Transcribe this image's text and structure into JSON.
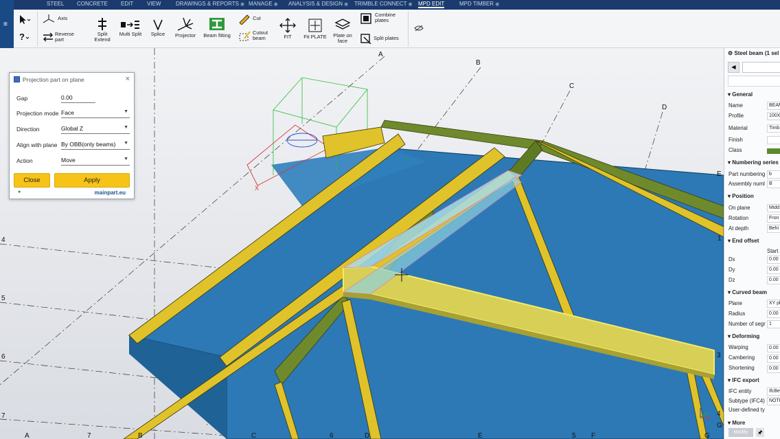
{
  "tabs": [
    "STEEL",
    "CONCRETE",
    "EDIT",
    "VIEW",
    "DRAWINGS & REPORTS",
    "MANAGE",
    "ANALYSIS & DESIGN",
    "TRIMBLE CONNECT",
    "MPD EDIT",
    "MPD TIMBER"
  ],
  "active_tab": "MPD EDIT",
  "ribbon": {
    "axis": "Axis",
    "reverse_part": "Reverse part",
    "split_extend": "Split Extend",
    "multi_split": "Multi Split",
    "splice": "Splice",
    "projector": "Projector",
    "beam_fitting": "Beam fitting",
    "cut": "Cut",
    "cutout_beam": "Cutout beam",
    "fit": "FIT",
    "fit_plate": "Fit PLATE",
    "plate_on_face": "Plate on face",
    "combine_plates": "Combine plates",
    "split_plates": "Split plates"
  },
  "dialog": {
    "title": "Projection part on plane",
    "gap_label": "Gap",
    "gap_value": "0.00",
    "projection_mode_label": "Projection mode",
    "projection_mode_value": "Face",
    "direction_label": "Direction",
    "direction_value": "Global Z",
    "align_label": "Align with plane",
    "align_value": "By OBB(only beams)",
    "action_label": "Action",
    "action_value": "Move",
    "close": "Close",
    "apply": "Apply",
    "brand": "mainpart.eu"
  },
  "grid_labels": {
    "top": [
      "A",
      "B",
      "C",
      "D",
      "E"
    ],
    "left": [
      "4",
      "5",
      "6",
      "7"
    ],
    "bottom": [
      "A",
      "7",
      "B",
      "C",
      "6",
      "D",
      "E",
      "5",
      "F",
      "G"
    ],
    "right": [
      "1",
      "3",
      "4",
      "G"
    ],
    "axes": [
      "X",
      "Y"
    ]
  },
  "properties": {
    "header": "Steel beam (1 sel",
    "general": "General",
    "name_label": "Name",
    "name_value": "BEAM",
    "profile_label": "Profile",
    "profile_value": "100X",
    "material_label": "Material",
    "material_value": "Timb",
    "finish_label": "Finish",
    "class_label": "Class",
    "numbering": "Numbering series",
    "part_numbering_label": "Part numbering",
    "part_numbering_value": "b",
    "assembly_label": "Assembly numl",
    "assembly_value": "B",
    "position": "Position",
    "on_plane_label": "On plane",
    "on_plane_value": "Midd",
    "rotation_label": "Rotation",
    "rotation_value": "Fron",
    "at_depth_label": "At depth",
    "at_depth_value": "Behi",
    "end_offset": "End offset",
    "start": "Start",
    "dx_label": "Dx",
    "dy_label": "Dy",
    "dz_label": "Dz",
    "zero": "0.00",
    "curved_beam": "Curved beam",
    "plane_label": "Plane",
    "plane_value": "XY pl",
    "radius_label": "Radius",
    "segments_label": "Number of segr",
    "segments_value": "1",
    "deforming": "Deforming",
    "warping_label": "Warping",
    "cambering_label": "Cambering",
    "shortening_label": "Shortening",
    "ifc_export": "IFC export",
    "ifc_entity_label": "IFC entity",
    "ifc_entity_value": "IfcBe",
    "subtype_label": "Subtype (IFC4)",
    "subtype_value": "NOTI",
    "user_defined_label": "User-defined ty",
    "more": "More",
    "modify": "Modify"
  },
  "colors": {
    "ribbon_bar": "#1b3b6e",
    "plate_blue": "#2c79b5",
    "beam_yellow": "#e0c22a",
    "beam_green": "#6e8a2c",
    "selection": "#f4e46a",
    "button_yellow": "#f7c317"
  }
}
